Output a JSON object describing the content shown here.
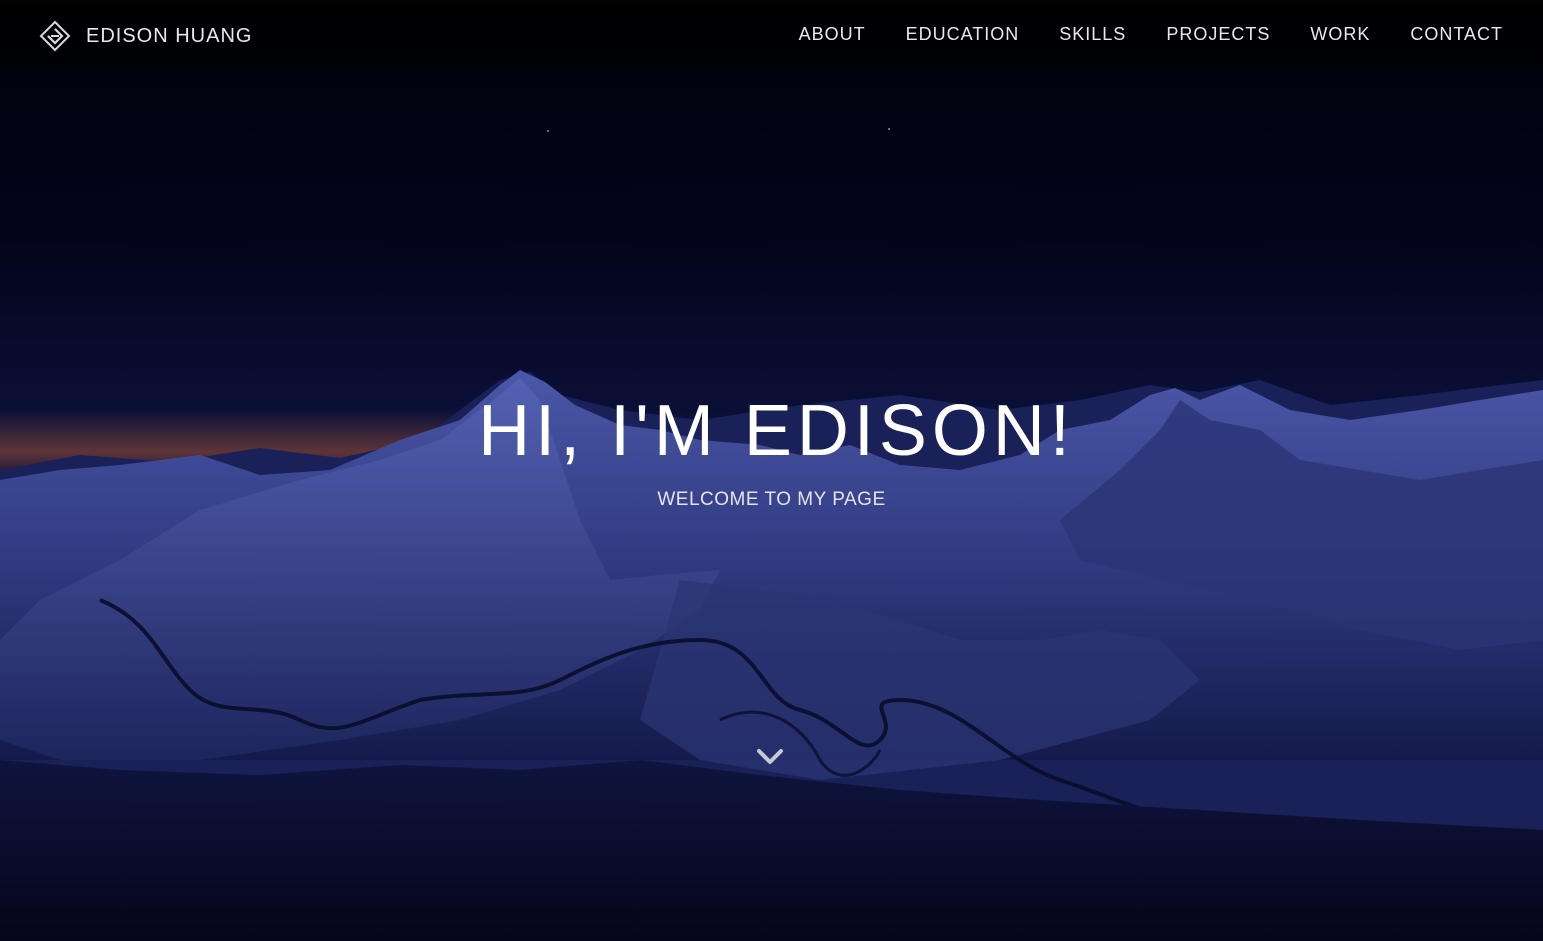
{
  "header": {
    "brand_name": "EDISON HUANG",
    "logo_icon": "diamond-logo-icon",
    "nav_items": [
      {
        "label": "ABOUT"
      },
      {
        "label": "EDUCATION"
      },
      {
        "label": "SKILLS"
      },
      {
        "label": "PROJECTS"
      },
      {
        "label": "WORK"
      },
      {
        "label": "CONTACT"
      }
    ]
  },
  "hero": {
    "title": "HI, I'M EDISON!",
    "subtitle": "WELCOME TO MY PAGE",
    "scroll_icon": "chevron-down-icon",
    "background": "night-mountain-landscape"
  },
  "colors": {
    "text": "#ffffff",
    "nav_text": "#e8e8ee",
    "sky_dark": "#010109",
    "mountain_blue": "#3a4590",
    "horizon_glow": "#c2623a"
  }
}
